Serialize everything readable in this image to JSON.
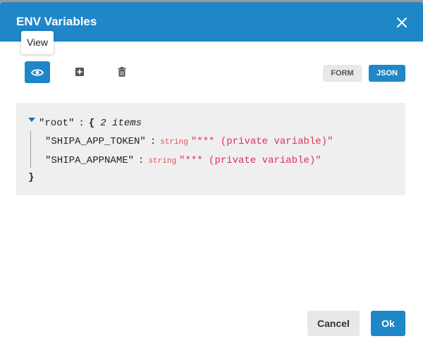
{
  "dialog": {
    "title": "ENV Variables",
    "close_icon": "close-icon",
    "tooltip": "View"
  },
  "toolbar": {
    "view_icon": "eye-icon",
    "add_icon": "plus-square-icon",
    "delete_icon": "trash-icon",
    "form_label": "FORM",
    "json_label": "JSON"
  },
  "json_view": {
    "root_key": "\"root\"",
    "colon": ":",
    "open_brace": "{",
    "items_meta": "2 items",
    "close_brace": "}",
    "entries": [
      {
        "key": "\"SHIPA_APP_TOKEN\"",
        "type": "string",
        "value": "\"*** (private variable)\""
      },
      {
        "key": "\"SHIPA_APPNAME\"",
        "type": "string",
        "value": "\"*** (private variable)\""
      }
    ]
  },
  "footer": {
    "cancel_label": "Cancel",
    "ok_label": "Ok"
  },
  "colors": {
    "primary": "#1f87c8",
    "secondary_button": "#e8e8e8",
    "json_value": "#e0315a"
  }
}
